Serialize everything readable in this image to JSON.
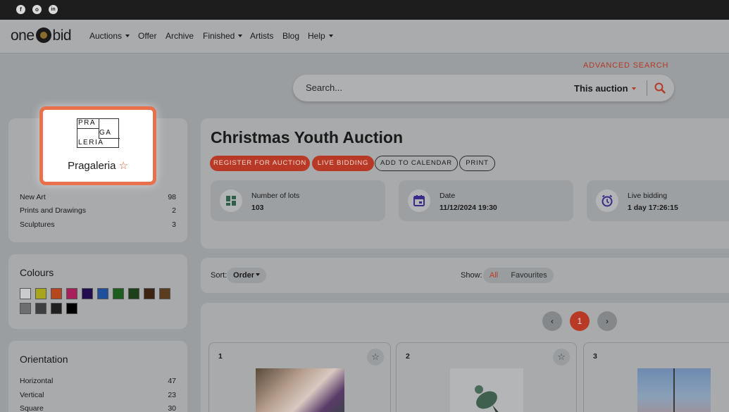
{
  "social": {
    "facebook": "f",
    "instagram": "o",
    "linkedin": "in"
  },
  "nav": {
    "logo_left": "one",
    "logo_right": "bid",
    "items": [
      {
        "label": "Auctions",
        "dropdown": true
      },
      {
        "label": "Offer",
        "dropdown": false
      },
      {
        "label": "Archive",
        "dropdown": false
      },
      {
        "label": "Finished",
        "dropdown": true
      },
      {
        "label": "Artists",
        "dropdown": false
      },
      {
        "label": "Blog",
        "dropdown": false
      },
      {
        "label": "Help",
        "dropdown": true
      }
    ]
  },
  "search": {
    "advanced_label": "ADVANCED SEARCH",
    "placeholder": "Search...",
    "scope": "This auction",
    "icon": "search-icon"
  },
  "seller": {
    "logo_lines": [
      "PRA",
      "GA",
      "LERIA"
    ],
    "name": "Pragaleria",
    "fav_icon": "☆"
  },
  "categories": [
    {
      "label": "New Art",
      "count": "98"
    },
    {
      "label": "Prints and Drawings",
      "count": "2"
    },
    {
      "label": "Sculptures",
      "count": "3"
    }
  ],
  "colours": {
    "title": "Colours",
    "swatches": [
      "#c9cbcc",
      "#a8a51c",
      "#b5461e",
      "#a8205a",
      "#240d4f",
      "#1d4f9a",
      "#1d5e1f",
      "#1d3f1a",
      "#3d2410",
      "#5c3c1e",
      "#6c6e70",
      "#3e3f40",
      "#1f1f1f",
      "#000000"
    ]
  },
  "orientation": {
    "title": "Orientation",
    "items": [
      {
        "label": "Horizontal",
        "count": "47"
      },
      {
        "label": "Vertical",
        "count": "23"
      },
      {
        "label": "Square",
        "count": "30"
      }
    ]
  },
  "auction": {
    "title": "Christmas Youth Auction",
    "buttons": {
      "register": "REGISTER FOR AUCTION",
      "live": "LIVE BIDDING",
      "calendar": "ADD TO CALENDAR",
      "print": "PRINT"
    },
    "info": [
      {
        "label": "Number of lots",
        "value": "103",
        "icon": "grid-icon"
      },
      {
        "label": "Date",
        "value": "11/12/2024 19:30",
        "icon": "calendar-icon"
      },
      {
        "label": "Live bidding",
        "value": "1 day 17:26:15",
        "icon": "alarm-clock-icon"
      }
    ]
  },
  "toolbar": {
    "sort_label": "Sort:",
    "sort_value": "Order",
    "show_label": "Show:",
    "show_all": "All",
    "show_favourites": "Favourites"
  },
  "pagination": {
    "prev": "‹",
    "current": "1",
    "next": "›"
  },
  "lots": [
    {
      "number": "1"
    },
    {
      "number": "2"
    },
    {
      "number": "3"
    }
  ],
  "colors": {
    "accent": "#b83a26",
    "highlight_border": "#e8704a"
  }
}
